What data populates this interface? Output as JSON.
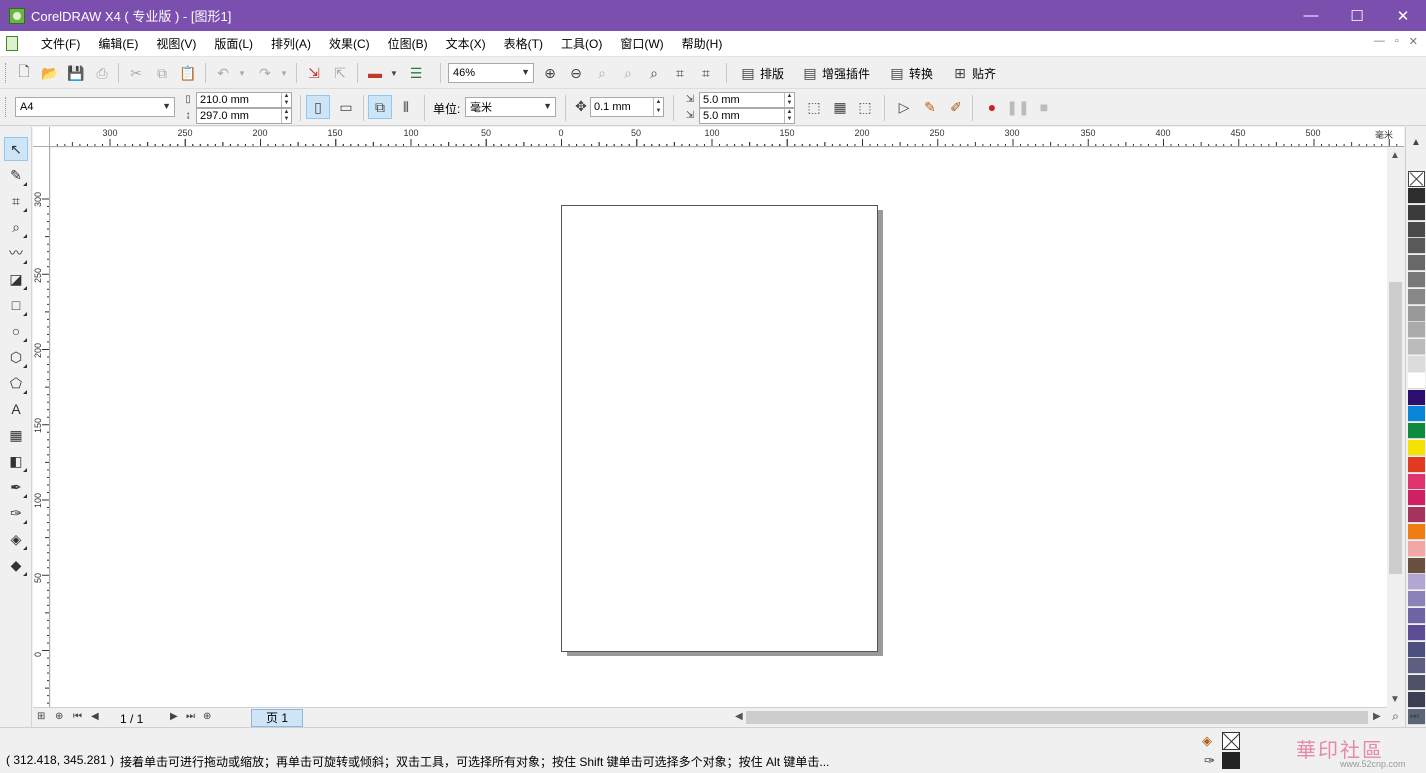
{
  "window": {
    "title": "CorelDRAW X4 ( 专业版 ) - [图形1]",
    "minimize": "—",
    "maximize": "☐",
    "close": "✕"
  },
  "menu": {
    "items": [
      "文件(F)",
      "编辑(E)",
      "视图(V)",
      "版面(L)",
      "排列(A)",
      "效果(C)",
      "位图(B)",
      "文本(X)",
      "表格(T)",
      "工具(O)",
      "窗口(W)",
      "帮助(H)"
    ],
    "mdi_controls": [
      "—",
      "▫",
      "✕"
    ]
  },
  "toolbar": {
    "zoom_value": "46%",
    "buttons": [
      "排版",
      "增强插件",
      "转换",
      "贴齐"
    ]
  },
  "property_bar": {
    "paper_size": "A4",
    "width": "210.0 mm",
    "height": "297.0 mm",
    "unit_label": "单位:",
    "unit_value": "毫米",
    "nudge": "0.1 mm",
    "dup_x": "5.0 mm",
    "dup_y": "5.0 mm"
  },
  "ruler": {
    "h_labels": [
      "300",
      "250",
      "200",
      "150",
      "100",
      "50",
      "0",
      "50",
      "100",
      "150",
      "200",
      "250",
      "300",
      "350",
      "400",
      "450",
      "500",
      "毫米"
    ],
    "v_labels": [
      "300",
      "250",
      "200",
      "150",
      "100",
      "50",
      "0"
    ]
  },
  "page_nav": {
    "counter": "1 / 1",
    "tab_label": "页 1"
  },
  "status": {
    "coords": "( 312.418, 345.281 )",
    "hint": "接着单击可进行拖动或缩放；再单击可旋转或倾斜；双击工具，可选择所有对象；按住 Shift 键单击可选择多个对象；按住 Alt 键单击...",
    "watermark": "華印社區",
    "watermark_url": "www.52cnp.com"
  },
  "palette": [
    "#2d2d2d",
    "#3b3b3b",
    "#4a4a4a",
    "#595959",
    "#686868",
    "#787878",
    "#888888",
    "#999999",
    "#aaaaaa",
    "#bbbbbb",
    "#dcdcdc",
    "#ffffff",
    "#2a0f6e",
    "#0a86d9",
    "#0e8a3c",
    "#f5e400",
    "#e03a20",
    "#e0336f",
    "#d01f62",
    "#a6335e",
    "#ef7d12",
    "#f2a6a6",
    "#6b5040",
    "#b0a8d2",
    "#8b82b8",
    "#6e64a5",
    "#5b4d95",
    "#4d4f7e",
    "#5e5e82",
    "#4e5066",
    "#3a3f55",
    "#5c6478"
  ]
}
